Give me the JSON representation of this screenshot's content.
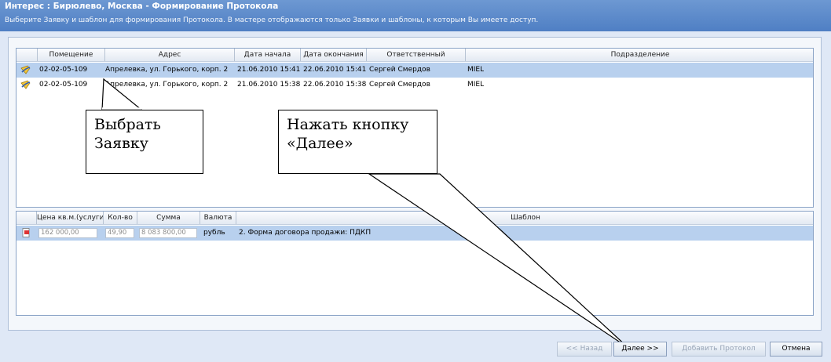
{
  "window": {
    "title": "Интерес : Бирюлево, Москва - Формирование Протокола",
    "subtitle": "Выберите Заявку и шаблон для формирования Протокола. В мастере отображаются только Заявки и шаблоны, к которым Вы имеете доступ."
  },
  "requests_grid": {
    "columns": [
      "Помещение",
      "Адрес",
      "Дата начала",
      "Дата окончания",
      "Ответственный",
      "Подразделение"
    ],
    "rows": [
      {
        "icon": "request-icon",
        "room": "02-02-05-109",
        "address": "Апрелевка, ул. Горького, корп. 2",
        "start": "21.06.2010 15:41",
        "end": "22.06.2010 15:41",
        "responsible": "Сергей Смердов",
        "department": "MIEL",
        "selected": true
      },
      {
        "icon": "request-icon",
        "room": "02-02-05-109",
        "address": "Апрелевка, ул. Горького, корп. 2",
        "start": "21.06.2010 15:38",
        "end": "22.06.2010 15:38",
        "responsible": "Сергей Смердов",
        "department": "MIEL",
        "selected": false
      }
    ]
  },
  "templates_grid": {
    "columns": [
      "Цена кв.м.(услуги)",
      "Кол-во",
      "Сумма",
      "Валюта",
      "Шаблон"
    ],
    "rows": [
      {
        "icon": "document-icon",
        "price": "162 000,00",
        "qty": "49,90",
        "sum": "8 083 800,00",
        "currency": "рубль",
        "template": "2. Форма договора продажи: ПДКП",
        "selected": true
      }
    ]
  },
  "callouts": {
    "select_request": "Выбрать Заявку",
    "press_next": "Нажать кнопку «Далее»"
  },
  "buttons": {
    "back": "<< Назад",
    "next": "Далее >>",
    "add_protocol": "Добавить Протокол",
    "cancel": "Отмена"
  }
}
